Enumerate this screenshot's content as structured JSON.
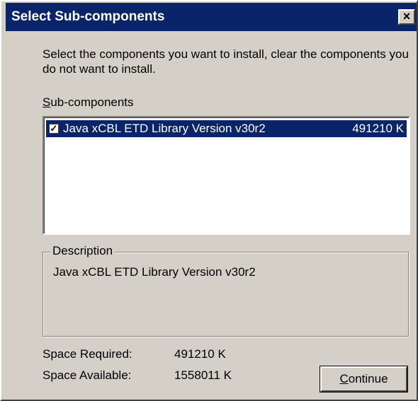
{
  "window": {
    "title": "Select Sub-components",
    "close_glyph": "×"
  },
  "instructions": "Select the components you want to install, clear the components you do not want to install.",
  "subcomponents": {
    "label_first": "S",
    "label_rest": "ub-components",
    "items": [
      {
        "checked": true,
        "name": "Java xCBL ETD Library Version v30r2",
        "size": "491210 K"
      }
    ]
  },
  "description": {
    "legend": "Description",
    "text": "Java xCBL ETD Library Version v30r2"
  },
  "space": {
    "required_label": "Space Required:",
    "required_value": "491210 K",
    "available_label": "Space Available:",
    "available_value": "1558011 K"
  },
  "continue_button": {
    "label_first": "C",
    "label_rest": "ontinue"
  },
  "colors": {
    "title_bar": "#0a246a",
    "face": "#d4d0c8",
    "selection": "#0a246a"
  }
}
